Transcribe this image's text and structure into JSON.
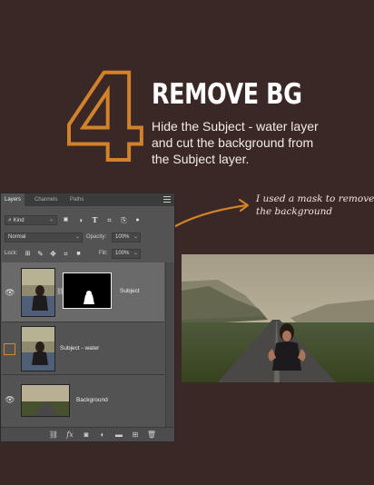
{
  "step": {
    "number": "4",
    "title": "REMOVE BG",
    "description_lines": [
      "Hide the Subject - water layer",
      "and cut the background from",
      "the Subject layer."
    ]
  },
  "annotation": {
    "lines": [
      "I used a mask to remove",
      "the background"
    ]
  },
  "layers_panel": {
    "tabs": [
      "Layers",
      "Channels",
      "Paths"
    ],
    "filter": {
      "label": "Kind"
    },
    "blend_mode": "Normal",
    "opacity_label": "Opacity:",
    "opacity_value": "100%",
    "lock_label": "Lock:",
    "fill_label": "Fill:",
    "fill_value": "100%",
    "layers": [
      {
        "name": "Subject",
        "visible": true,
        "selected": true,
        "has_mask": true
      },
      {
        "name": "Subject - water",
        "visible": false,
        "selected": false,
        "has_mask": false
      },
      {
        "name": "Background",
        "visible": true,
        "selected": false,
        "has_mask": false
      }
    ],
    "footer_icons": [
      "link-layers-icon",
      "fx-icon",
      "add-mask-icon",
      "adjustment-layer-icon",
      "new-group-icon",
      "new-layer-icon",
      "trash-icon"
    ]
  },
  "colors": {
    "background": "#3a2826",
    "accent_orange": "#d2822b",
    "panel": "#535353"
  }
}
